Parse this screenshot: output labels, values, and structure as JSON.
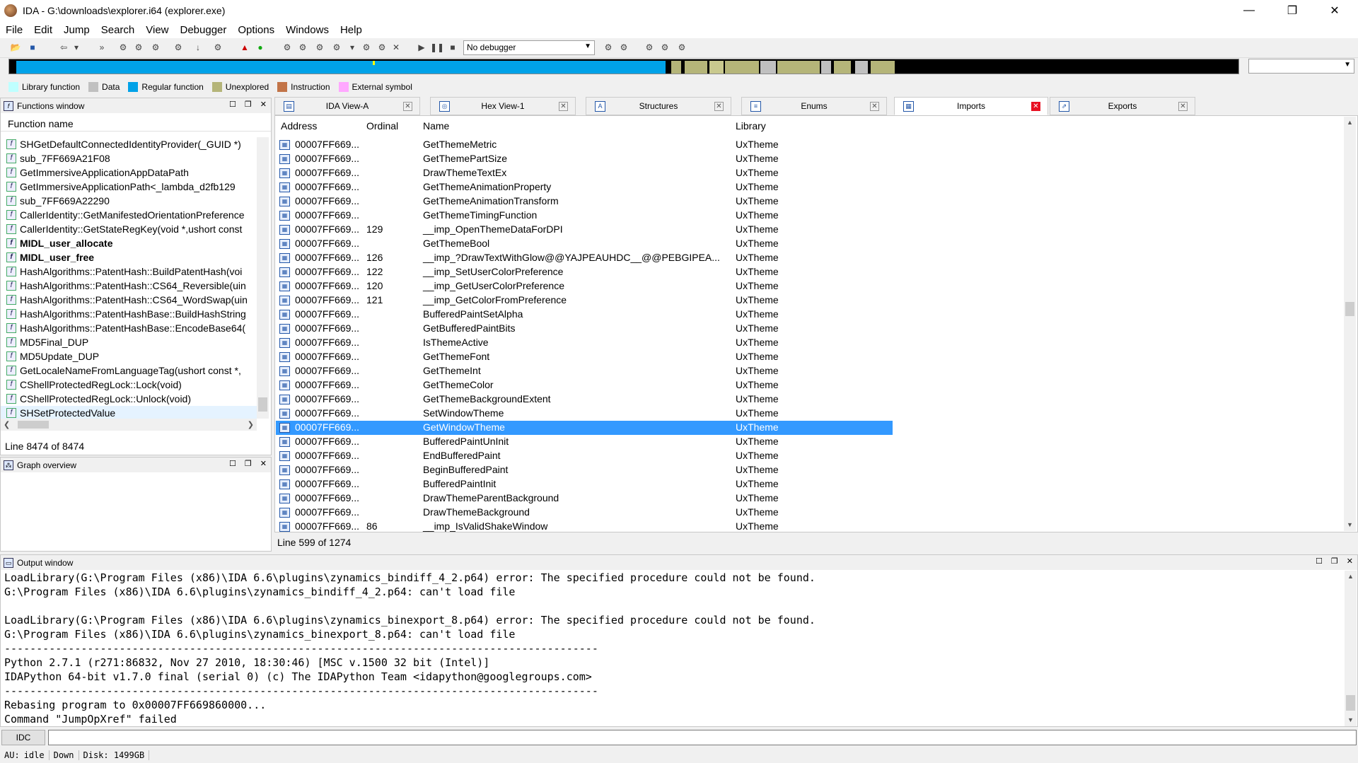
{
  "window": {
    "title": "IDA - G:\\downloads\\explorer.i64 (explorer.exe)",
    "minimize_glyph": "—",
    "maximize_glyph": "❐",
    "close_glyph": "✕"
  },
  "menu": [
    "File",
    "Edit",
    "Jump",
    "Search",
    "View",
    "Debugger",
    "Options",
    "Windows",
    "Help"
  ],
  "toolbar": {
    "debugger_value": "No debugger"
  },
  "legend": [
    {
      "label": "Library function",
      "color": "#bfffff"
    },
    {
      "label": "Data",
      "color": "#c0c0c0"
    },
    {
      "label": "Regular function",
      "color": "#00a2e8"
    },
    {
      "label": "Unexplored",
      "color": "#b5b579"
    },
    {
      "label": "Instruction",
      "color": "#c27448"
    },
    {
      "label": "External symbol",
      "color": "#ffa8ff"
    }
  ],
  "functions_window": {
    "title": "Functions window",
    "column": "Function name",
    "rows": [
      {
        "name": "SHGetDefaultConnectedIdentityProvider(_GUID *)",
        "bold": false
      },
      {
        "name": "sub_7FF669A21F08",
        "bold": false
      },
      {
        "name": "GetImmersiveApplicationAppDataPath",
        "bold": false
      },
      {
        "name": "GetImmersiveApplicationPath<_lambda_d2fb129",
        "bold": false
      },
      {
        "name": "sub_7FF669A22290",
        "bold": false
      },
      {
        "name": "CallerIdentity::GetManifestedOrientationPreference",
        "bold": false
      },
      {
        "name": "CallerIdentity::GetStateRegKey(void *,ushort const",
        "bold": false
      },
      {
        "name": "MIDL_user_allocate",
        "bold": true
      },
      {
        "name": "MIDL_user_free",
        "bold": true
      },
      {
        "name": "HashAlgorithms::PatentHash::BuildPatentHash(voi",
        "bold": false
      },
      {
        "name": "HashAlgorithms::PatentHash::CS64_Reversible(uin",
        "bold": false
      },
      {
        "name": "HashAlgorithms::PatentHash::CS64_WordSwap(uin",
        "bold": false
      },
      {
        "name": "HashAlgorithms::PatentHashBase::BuildHashString",
        "bold": false
      },
      {
        "name": "HashAlgorithms::PatentHashBase::EncodeBase64(",
        "bold": false
      },
      {
        "name": "MD5Final_DUP",
        "bold": false
      },
      {
        "name": "MD5Update_DUP",
        "bold": false
      },
      {
        "name": "GetLocaleNameFromLanguageTag(ushort const *,",
        "bold": false
      },
      {
        "name": "CShellProtectedRegLock::Lock(void)",
        "bold": false
      },
      {
        "name": "CShellProtectedRegLock::Unlock(void)",
        "bold": false
      },
      {
        "name": "SHSetProtectedValue",
        "bold": false
      }
    ],
    "status": "Line 8474 of 8474"
  },
  "graph_overview": {
    "title": "Graph overview"
  },
  "tabs": [
    {
      "label": "IDA View-A",
      "icon": "▤"
    },
    {
      "label": "Hex View-1",
      "icon": "◎"
    },
    {
      "label": "Structures",
      "icon": "A"
    },
    {
      "label": "Enums",
      "icon": "≡"
    },
    {
      "label": "Imports",
      "icon": "▦"
    },
    {
      "label": "Exports",
      "icon": "⇗"
    }
  ],
  "imports": {
    "columns": [
      "Address",
      "Ordinal",
      "Name",
      "Library"
    ],
    "rows": [
      {
        "address": "00007FF669...",
        "ordinal": "",
        "name": "GetThemeMetric",
        "library": "UxTheme"
      },
      {
        "address": "00007FF669...",
        "ordinal": "",
        "name": "GetThemePartSize",
        "library": "UxTheme"
      },
      {
        "address": "00007FF669...",
        "ordinal": "",
        "name": "DrawThemeTextEx",
        "library": "UxTheme"
      },
      {
        "address": "00007FF669...",
        "ordinal": "",
        "name": "GetThemeAnimationProperty",
        "library": "UxTheme"
      },
      {
        "address": "00007FF669...",
        "ordinal": "",
        "name": "GetThemeAnimationTransform",
        "library": "UxTheme"
      },
      {
        "address": "00007FF669...",
        "ordinal": "",
        "name": "GetThemeTimingFunction",
        "library": "UxTheme"
      },
      {
        "address": "00007FF669...",
        "ordinal": "129",
        "name": "__imp_OpenThemeDataForDPI",
        "library": "UxTheme"
      },
      {
        "address": "00007FF669...",
        "ordinal": "",
        "name": "GetThemeBool",
        "library": "UxTheme"
      },
      {
        "address": "00007FF669...",
        "ordinal": "126",
        "name": "__imp_?DrawTextWithGlow@@YAJPEAUHDC__@@PEBGIPEA...",
        "library": "UxTheme"
      },
      {
        "address": "00007FF669...",
        "ordinal": "122",
        "name": "__imp_SetUserColorPreference",
        "library": "UxTheme"
      },
      {
        "address": "00007FF669...",
        "ordinal": "120",
        "name": "__imp_GetUserColorPreference",
        "library": "UxTheme"
      },
      {
        "address": "00007FF669...",
        "ordinal": "121",
        "name": "__imp_GetColorFromPreference",
        "library": "UxTheme"
      },
      {
        "address": "00007FF669...",
        "ordinal": "",
        "name": "BufferedPaintSetAlpha",
        "library": "UxTheme"
      },
      {
        "address": "00007FF669...",
        "ordinal": "",
        "name": "GetBufferedPaintBits",
        "library": "UxTheme"
      },
      {
        "address": "00007FF669...",
        "ordinal": "",
        "name": "IsThemeActive",
        "library": "UxTheme"
      },
      {
        "address": "00007FF669...",
        "ordinal": "",
        "name": "GetThemeFont",
        "library": "UxTheme"
      },
      {
        "address": "00007FF669...",
        "ordinal": "",
        "name": "GetThemeInt",
        "library": "UxTheme"
      },
      {
        "address": "00007FF669...",
        "ordinal": "",
        "name": "GetThemeColor",
        "library": "UxTheme"
      },
      {
        "address": "00007FF669...",
        "ordinal": "",
        "name": "GetThemeBackgroundExtent",
        "library": "UxTheme"
      },
      {
        "address": "00007FF669...",
        "ordinal": "",
        "name": "SetWindowTheme",
        "library": "UxTheme"
      },
      {
        "address": "00007FF669...",
        "ordinal": "",
        "name": "GetWindowTheme",
        "library": "UxTheme",
        "selected": true
      },
      {
        "address": "00007FF669...",
        "ordinal": "",
        "name": "BufferedPaintUnInit",
        "library": "UxTheme"
      },
      {
        "address": "00007FF669...",
        "ordinal": "",
        "name": "EndBufferedPaint",
        "library": "UxTheme"
      },
      {
        "address": "00007FF669...",
        "ordinal": "",
        "name": "BeginBufferedPaint",
        "library": "UxTheme"
      },
      {
        "address": "00007FF669...",
        "ordinal": "",
        "name": "BufferedPaintInit",
        "library": "UxTheme"
      },
      {
        "address": "00007FF669...",
        "ordinal": "",
        "name": "DrawThemeParentBackground",
        "library": "UxTheme"
      },
      {
        "address": "00007FF669...",
        "ordinal": "",
        "name": "DrawThemeBackground",
        "library": "UxTheme"
      },
      {
        "address": "00007FF669...",
        "ordinal": "86",
        "name": "__imp_IsValidShakeWindow",
        "library": "UxTheme"
      }
    ],
    "status": "Line 599 of 1274"
  },
  "output_window": {
    "title": "Output window",
    "lines": [
      "LoadLibrary(G:\\Program Files (x86)\\IDA 6.6\\plugins\\zynamics_bindiff_4_2.p64) error: The specified procedure could not be found.",
      "G:\\Program Files (x86)\\IDA 6.6\\plugins\\zynamics_bindiff_4_2.p64: can't load file",
      "",
      "LoadLibrary(G:\\Program Files (x86)\\IDA 6.6\\plugins\\zynamics_binexport_8.p64) error: The specified procedure could not be found.",
      "G:\\Program Files (x86)\\IDA 6.6\\plugins\\zynamics_binexport_8.p64: can't load file",
      "---------------------------------------------------------------------------------------------",
      "Python 2.7.1 (r271:86832, Nov 27 2010, 18:30:46) [MSC v.1500 32 bit (Intel)]",
      "IDAPython 64-bit v1.7.0 final (serial 0) (c) The IDAPython Team <idapython@googlegroups.com>",
      "---------------------------------------------------------------------------------------------",
      "Rebasing program to 0x00007FF669860000...",
      "Command \"JumpOpXref\" failed"
    ]
  },
  "command": {
    "button": "IDC"
  },
  "status": {
    "au_label": "AU:",
    "au_value": "idle",
    "direction": "Down",
    "disk": "Disk: 1499GB"
  }
}
